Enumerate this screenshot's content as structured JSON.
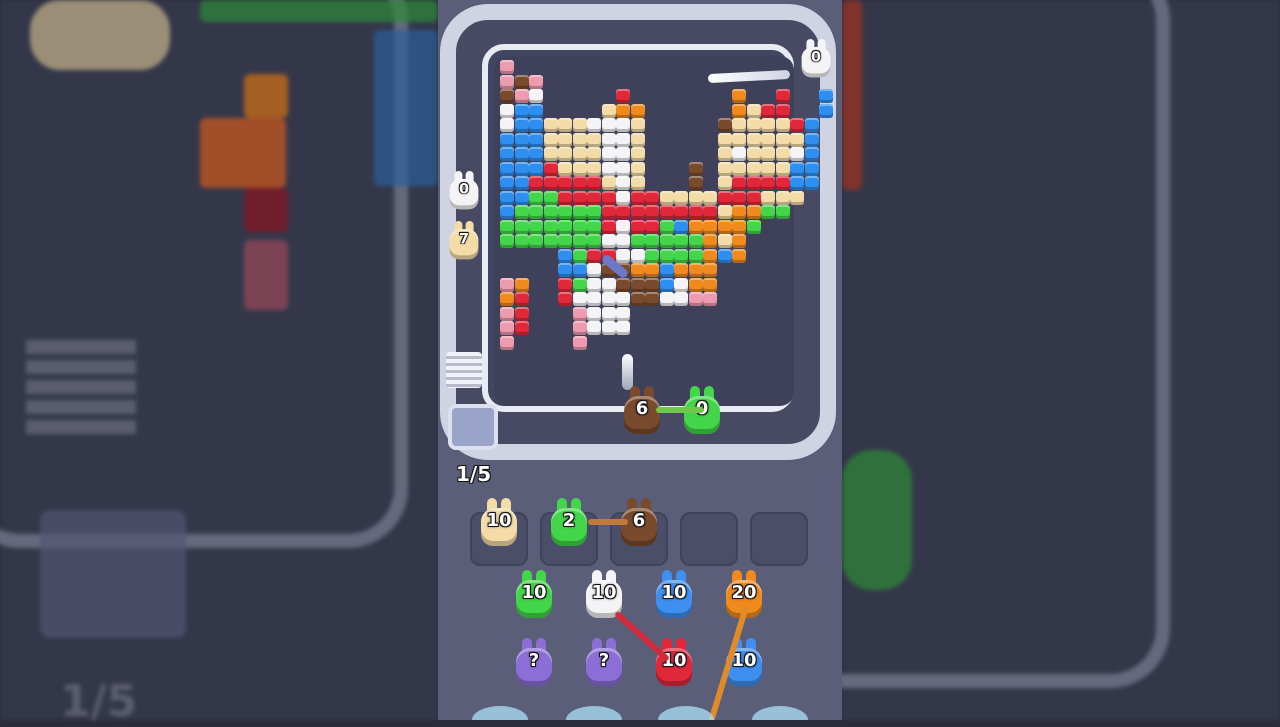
{
  "game": {
    "level_progress": "1/5",
    "conveyor_shooters": [
      {
        "id": "white-top",
        "count": "0",
        "color": "#f4f4f6"
      },
      {
        "id": "white-left",
        "count": "0",
        "color": "#f4f4f6"
      },
      {
        "id": "cream-left",
        "count": "7",
        "color": "#f3dca7"
      },
      {
        "id": "brown-bottom",
        "count": "6",
        "color": "#7a4a2c"
      },
      {
        "id": "green-bottom",
        "count": "0",
        "color": "#44d64a"
      }
    ],
    "holding_slots": [
      {
        "count": "10",
        "color": "#f3dca7"
      },
      {
        "count": "2",
        "color": "#44d64a"
      },
      {
        "count": "6",
        "color": "#7a4a2c"
      },
      {
        "count": "",
        "color": ""
      },
      {
        "count": "",
        "color": ""
      }
    ],
    "queue_row1": [
      {
        "count": "10",
        "color": "#44d64a"
      },
      {
        "count": "10",
        "color": "#f4f4f6"
      },
      {
        "count": "10",
        "color": "#3f8ff0"
      },
      {
        "count": "20",
        "color": "#f08a1c"
      }
    ],
    "queue_row2": [
      {
        "count": "?",
        "color": "#8c6fd6"
      },
      {
        "count": "?",
        "color": "#8c6fd6"
      },
      {
        "count": "10",
        "color": "#e0283a"
      },
      {
        "count": "10",
        "color": "#3f8ff0"
      }
    ],
    "palette": {
      "P": "#ee9bb0",
      "W": "#f4f4f6",
      "K": "#7a4a2c",
      "R": "#e0283a",
      "O": "#f08a1c",
      "Y": "#f3dca7",
      "B": "#2f8ff0",
      "G": "#44d64a"
    },
    "pixel_rows": [
      "P-..........................",
      "PKP.........................",
      "KPW.....R.......O..R..B",
      "WBB....YOO......OYRR..B",
      "WBBYYYWWWY.....KYYYYRB",
      "BBBYYYYWWY.....YYYYYYB",
      "BBBYYYYWWY.....YWYYYWB",
      "BBBRYYYWWY...K.YYYYYBB",
      "BBRRRRRYWY...K.YRRRRBB",
      "BBGGRRRRWRRYYYYRRRYYY",
      "BGGGGGGRRRRRRRRYOOGG",
      "GGGGGGGRWRRGBOOOOG",
      "GGGGGGGWWGGGGGOYO",
      "....BGRRWWGGGGOBO",
      "....BBWKKOOBOOO",
      "PO..RGWWKKKBWOO",
      "OR..RWWWWKKWWPP",
      "PR...PWWW",
      "PR...PWWW",
      "P....P"
    ]
  }
}
